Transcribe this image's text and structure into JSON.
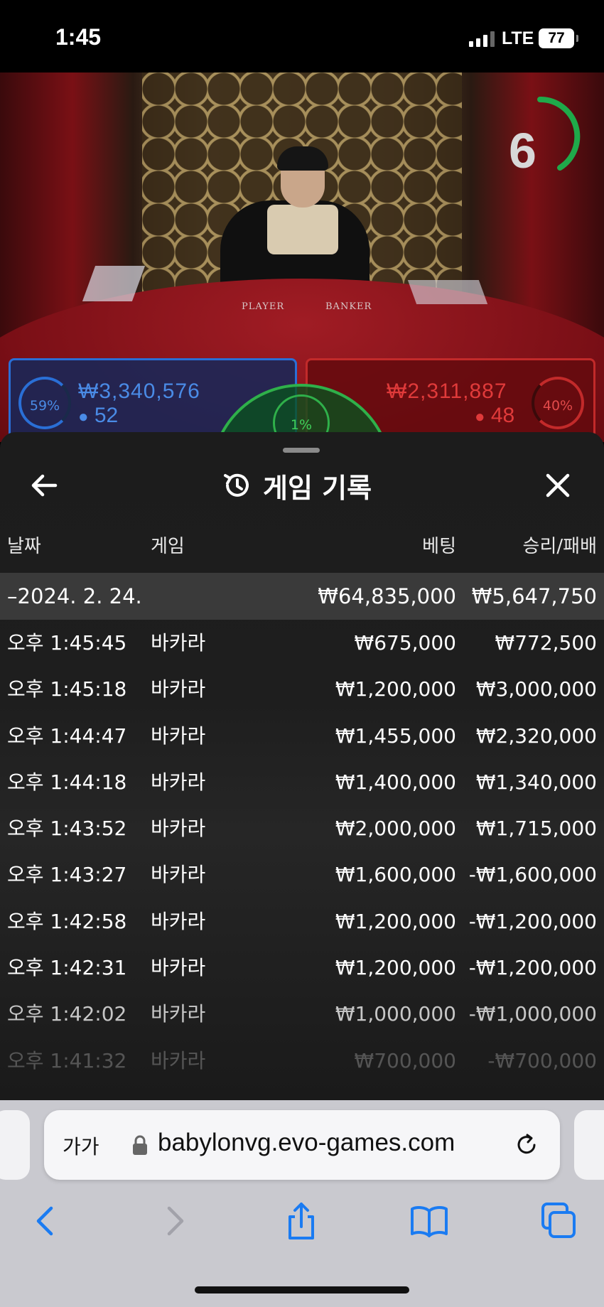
{
  "status_bar": {
    "time": "1:45",
    "network": "LTE",
    "battery": "77"
  },
  "video": {
    "countdown": "6",
    "table_player_text": "PLAYER",
    "table_banker_text": "BANKER",
    "player": {
      "percent": "59%",
      "amount": "₩3,340,576",
      "count": "52"
    },
    "banker": {
      "percent": "40%",
      "amount": "₩2,311,887",
      "count": "48"
    },
    "tie": {
      "percent": "1%"
    }
  },
  "history": {
    "title": "게임 기록",
    "columns": {
      "date": "날짜",
      "game": "게임",
      "bet": "베팅",
      "win_loss": "승리/패배"
    },
    "summary": {
      "date": "–2024. 2. 24.",
      "bet": "₩64,835,000",
      "win_loss": "₩5,647,750"
    },
    "rows": [
      {
        "time": "오후 1:45:45",
        "game": "바카라",
        "bet": "₩675,000",
        "win_loss": "₩772,500"
      },
      {
        "time": "오후 1:45:18",
        "game": "바카라",
        "bet": "₩1,200,000",
        "win_loss": "₩3,000,000"
      },
      {
        "time": "오후 1:44:47",
        "game": "바카라",
        "bet": "₩1,455,000",
        "win_loss": "₩2,320,000"
      },
      {
        "time": "오후 1:44:18",
        "game": "바카라",
        "bet": "₩1,400,000",
        "win_loss": "₩1,340,000"
      },
      {
        "time": "오후 1:43:52",
        "game": "바카라",
        "bet": "₩2,000,000",
        "win_loss": "₩1,715,000"
      },
      {
        "time": "오후 1:43:27",
        "game": "바카라",
        "bet": "₩1,600,000",
        "win_loss": "-₩1,600,000"
      },
      {
        "time": "오후 1:42:58",
        "game": "바카라",
        "bet": "₩1,200,000",
        "win_loss": "-₩1,200,000"
      },
      {
        "time": "오후 1:42:31",
        "game": "바카라",
        "bet": "₩1,200,000",
        "win_loss": "-₩1,200,000"
      },
      {
        "time": "오후 1:42:02",
        "game": "바카라",
        "bet": "₩1,000,000",
        "win_loss": "-₩1,000,000"
      },
      {
        "time": "오후 1:41:32",
        "game": "바카라",
        "bet": "₩700,000",
        "win_loss": "-₩700,000"
      }
    ]
  },
  "browser": {
    "aa_label": "가가",
    "url": "babylonvg.evo-games.com"
  },
  "colors": {
    "player_blue": "#2a6fd6",
    "banker_red": "#c22a2a",
    "tie_green": "#2fb04a",
    "safari_blue": "#1a7bf2"
  }
}
